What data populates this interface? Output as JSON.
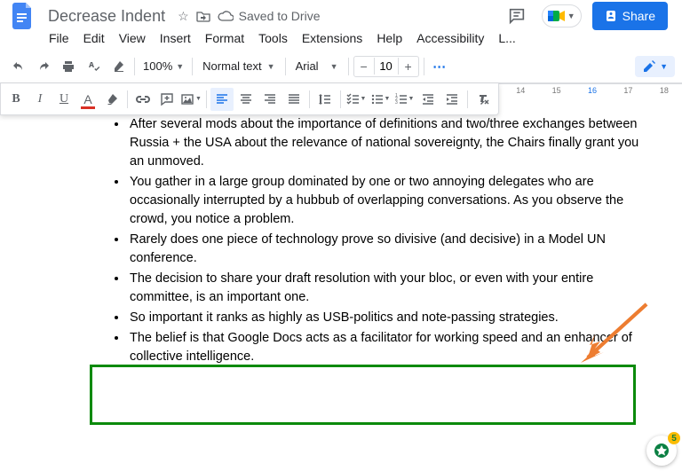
{
  "doc": {
    "title": "Decrease Indent",
    "saved": "Saved to Drive"
  },
  "menus": [
    "File",
    "Edit",
    "View",
    "Insert",
    "Format",
    "Tools",
    "Extensions",
    "Help",
    "Accessibility",
    "L..."
  ],
  "toolbar": {
    "zoom": "100%",
    "style": "Normal text",
    "font": "Arial",
    "fontSize": "10",
    "share": "Share"
  },
  "ruler": [
    "14",
    "15",
    "16",
    "17",
    "18"
  ],
  "bullets": [
    "After several mods about the importance of definitions and two/three exchanges between Russia + the USA about the relevance of national sovereignty, the Chairs finally grant you an unmoved.",
    "You gather in a large group dominated by one or two annoying delegates who are occasionally interrupted by a hubbub of overlapping conversations. As you observe the crowd, you notice a problem.",
    "Rarely does one piece of technology prove so divisive (and decisive) in a Model UN conference.",
    "The decision to share your draft resolution with your bloc, or even with your entire committee, is an important one.",
    "So important it ranks as highly as USB-politics and note-passing strategies.",
    "The belief is that Google Docs acts as a facilitator for working speed and an enhancer of collective intelligence."
  ],
  "explore": {
    "count": "5"
  }
}
